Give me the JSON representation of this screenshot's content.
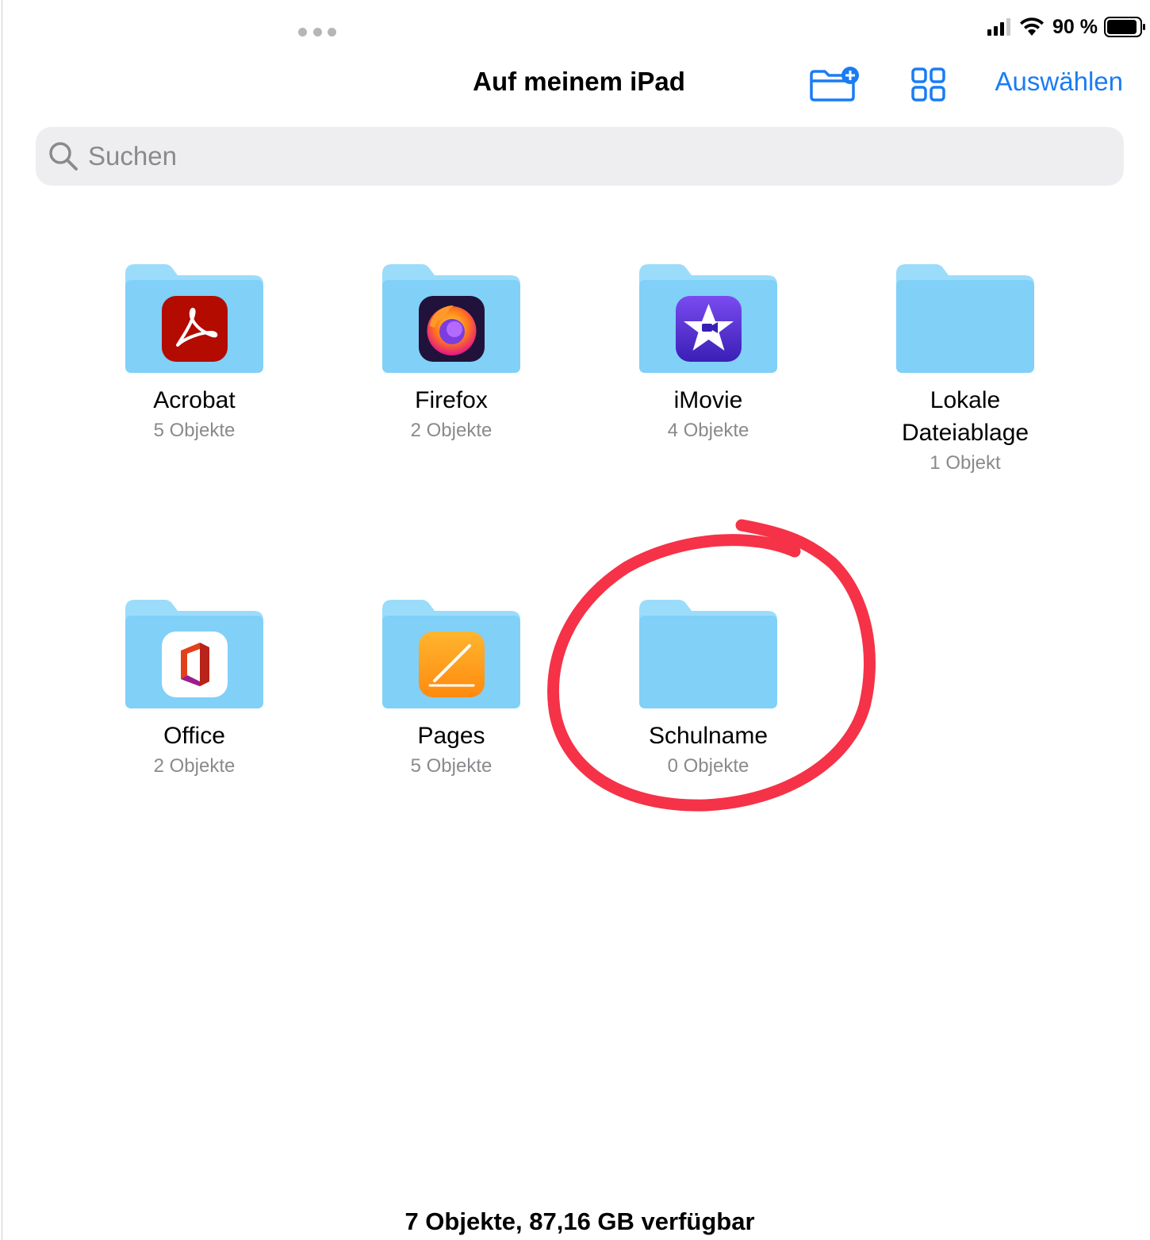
{
  "status_bar": {
    "battery": "90 %"
  },
  "nav": {
    "title": "Auf meinem iPad",
    "select_label": "Auswählen"
  },
  "search": {
    "placeholder": "Suchen",
    "value": ""
  },
  "folders": [
    {
      "name": "Acrobat",
      "count": "5 Objekte",
      "icon": "acrobat-icon"
    },
    {
      "name": "Firefox",
      "count": "2 Objekte",
      "icon": "firefox-icon"
    },
    {
      "name": "iMovie",
      "count": "4 Objekte",
      "icon": "imovie-icon"
    },
    {
      "name": "Lokale Dateiablage",
      "count": "1 Objekt",
      "icon": "none"
    },
    {
      "name": "Office",
      "count": "2 Objekte",
      "icon": "office-icon"
    },
    {
      "name": "Pages",
      "count": "5 Objekte",
      "icon": "pages-icon"
    },
    {
      "name": "Schulname",
      "count": "0 Objekte",
      "icon": "none"
    }
  ],
  "footer": {
    "summary": "7 Objekte, 87,16 GB verfügbar"
  },
  "colors": {
    "accent": "#1a7cf5",
    "folder_light": "#9bdcfb",
    "folder_main": "#80d0f7",
    "annotation": "#f53247"
  }
}
